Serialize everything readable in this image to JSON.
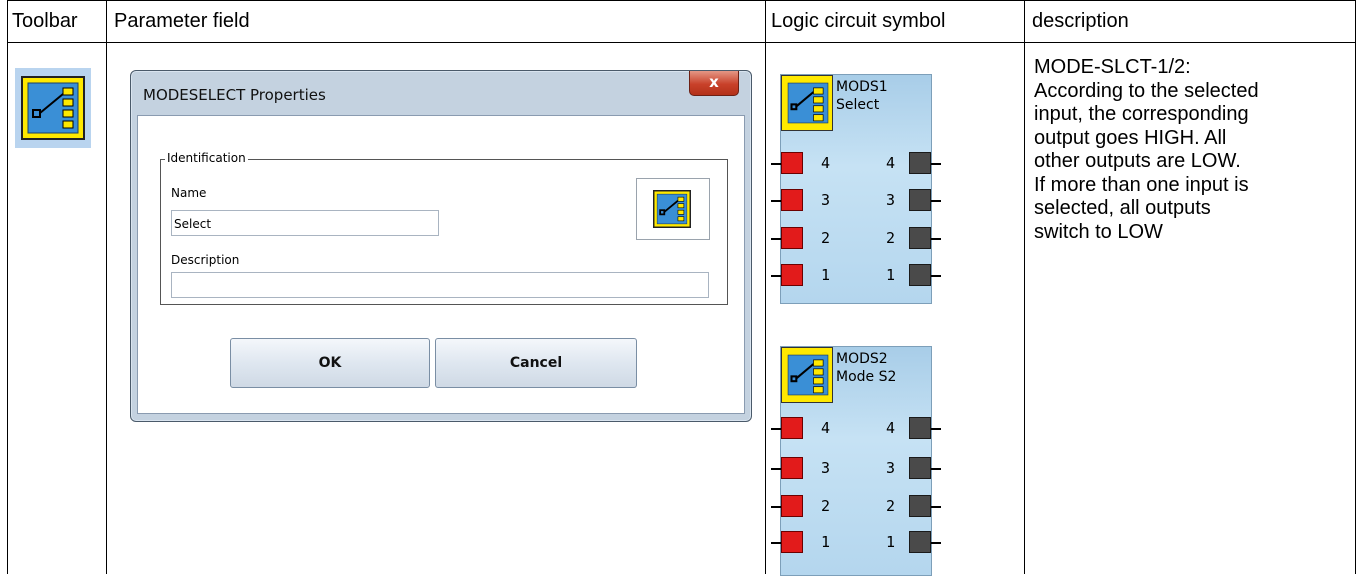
{
  "table": {
    "headers": [
      "Toolbar",
      "Parameter field",
      "Logic circuit symbol",
      "description"
    ]
  },
  "toolbar": {
    "icon": "mode-select-icon"
  },
  "dialog": {
    "title": "MODESELECT Properties",
    "close_label": "x",
    "group_label": "Identification",
    "name_label": "Name",
    "name_value": "Select",
    "description_label": "Description",
    "description_value": "",
    "ok_label": "OK",
    "cancel_label": "Cancel"
  },
  "blocks": [
    {
      "line1": "MODS1",
      "line2": "Select",
      "pins": [
        {
          "in": "4",
          "out": "4"
        },
        {
          "in": "3",
          "out": "3"
        },
        {
          "in": "2",
          "out": "2"
        },
        {
          "in": "1",
          "out": "1"
        }
      ]
    },
    {
      "line1": "MODS2",
      "line2": "Mode S2",
      "pins": [
        {
          "in": "4",
          "out": "4"
        },
        {
          "in": "3",
          "out": "3"
        },
        {
          "in": "2",
          "out": "2"
        },
        {
          "in": "1",
          "out": "1"
        }
      ]
    }
  ],
  "description": {
    "lines": [
      "MODE-SLCT-1/2:",
      "According to the selected",
      "input, the corresponding",
      "output goes HIGH. All",
      "other outputs are LOW.",
      "If more than one input is",
      "selected, all outputs",
      "switch to LOW"
    ]
  },
  "colors": {
    "icon_yellow": "#ffe900",
    "icon_blue": "#3a8fd6",
    "input_pin": "#e21b1b",
    "output_pin": "#4a4a4a",
    "block_fill": "#b4d6ee"
  }
}
